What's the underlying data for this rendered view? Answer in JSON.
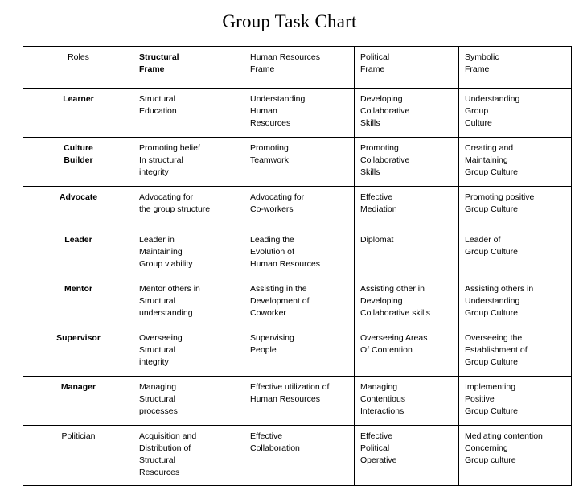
{
  "title": "Group Task Chart",
  "table": {
    "headers": [
      "Roles",
      "Structural\nFrame",
      "Human Resources\nFrame",
      "Political\nFrame",
      "Symbolic\nFrame"
    ],
    "rows": [
      {
        "role": "Learner",
        "structural": "Structural\nEducation",
        "human_resources": "Understanding\nHuman\nResources",
        "political": "Developing\nCollaborative\nSkills",
        "symbolic": "Understanding\nGroup\nCulture"
      },
      {
        "role": "Culture\nBuilder",
        "structural": "Promoting belief\nIn structural\nintegrity",
        "human_resources": "Promoting\nTeamwork",
        "political": "Promoting\nCollaborative\nSkills",
        "symbolic": "Creating and\nMaintaining\nGroup Culture"
      },
      {
        "role": "Advocate",
        "structural": "Advocating for\nthe group structure",
        "human_resources": "Advocating for\nCo-workers",
        "political": "Effective\nMediation",
        "symbolic": "Promoting positive\nGroup Culture"
      },
      {
        "role": "Leader",
        "structural": "Leader in\nMaintaining\nGroup viability",
        "human_resources": "Leading the\nEvolution of\nHuman Resources",
        "political": "Diplomat",
        "symbolic": "Leader of\nGroup Culture"
      },
      {
        "role": "Mentor",
        "structural": "Mentor others in\nStructural\nunderstanding",
        "human_resources": "Assisting in the\nDevelopment of\nCoworker",
        "political": "Assisting other in\nDeveloping\nCollaborative skills",
        "symbolic": "Assisting others in\nUnderstanding\nGroup Culture"
      },
      {
        "role": "Supervisor",
        "structural": "Overseeing\nStructural\nintegrity",
        "human_resources": "Supervising\nPeople",
        "political": "Overseeing Areas\nOf Contention",
        "symbolic": "Overseeing the\nEstablishment of\nGroup Culture"
      },
      {
        "role": "Manager",
        "structural": "Managing\nStructural\nprocesses",
        "human_resources": "Effective utilization of\nHuman Resources",
        "political": "Managing\nContentious\nInteractions",
        "symbolic": "Implementing\nPositive\nGroup Culture"
      },
      {
        "role": "Politician",
        "structural": "Acquisition and\nDistribution of\nStructural\nResources",
        "human_resources": "Effective\nCollaboration",
        "political": "Effective\nPolitical\nOperative",
        "symbolic": "Mediating contention\nConcerning\nGroup culture"
      }
    ]
  }
}
